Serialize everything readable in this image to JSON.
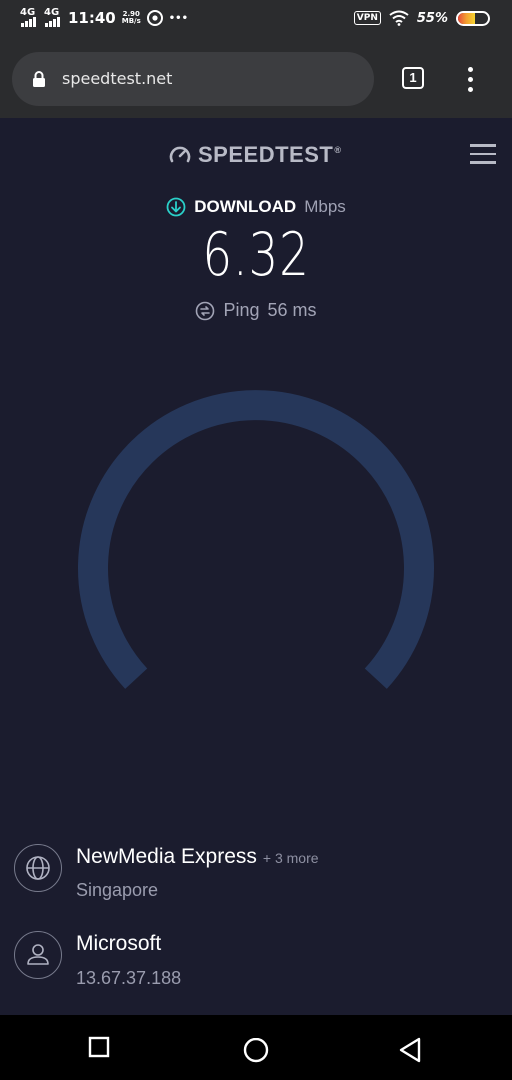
{
  "status_bar": {
    "network1": "4G",
    "network2": "4G",
    "time": "11:40",
    "net_speed_value": "2.90",
    "net_speed_unit": "MB/s",
    "more": "•••",
    "vpn": "VPN",
    "battery_percent": "55%",
    "battery_level": 0.55
  },
  "browser": {
    "url": "speedtest.net",
    "tab_count": "1"
  },
  "header": {
    "logo_text": "SPEEDTEST",
    "logo_mark": "®"
  },
  "result": {
    "label": "DOWNLOAD",
    "unit": "Mbps",
    "speed": "6.32",
    "ping_label": "Ping",
    "ping_value": "56 ms"
  },
  "server": {
    "isp_name": "NewMedia Express",
    "isp_more": "+ 3 more",
    "isp_location": "Singapore",
    "host_name": "Microsoft",
    "host_ip": "13.67.37.188"
  },
  "colors": {
    "background": "#1b1c2e",
    "gauge_track": "#26375a",
    "download_accent": "#2ad0c9"
  }
}
